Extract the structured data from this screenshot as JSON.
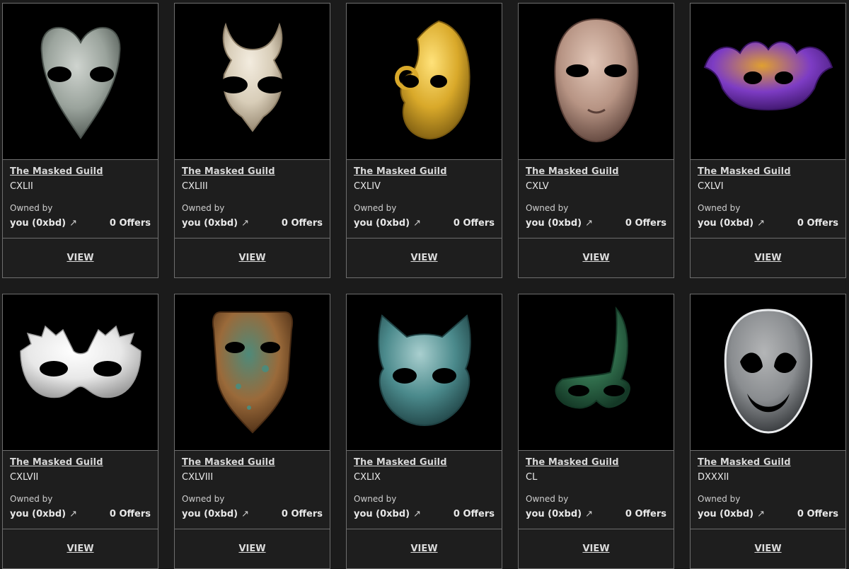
{
  "cards": [
    {
      "collection": "The Masked Guild",
      "token": "CXLII",
      "owned_label": "Owned by",
      "owner": "you (0xbd)",
      "arrow": "↗",
      "offers": "0 Offers",
      "view": "VIEW",
      "mask": "heart",
      "colors": [
        "#9aa39c",
        "#4b534e",
        "#cfd4cf"
      ]
    },
    {
      "collection": "The Masked Guild",
      "token": "CXLIII",
      "owned_label": "Owned by",
      "owner": "you (0xbd)",
      "arrow": "↗",
      "offers": "0 Offers",
      "view": "VIEW",
      "mask": "horned",
      "colors": [
        "#d8cdb8",
        "#8e7f68",
        "#f3ecdf"
      ]
    },
    {
      "collection": "The Masked Guild",
      "token": "CXLIV",
      "owned_label": "Owned by",
      "owner": "you (0xbd)",
      "arrow": "↗",
      "offers": "0 Offers",
      "view": "VIEW",
      "mask": "half",
      "colors": [
        "#d9a92a",
        "#7a5a10",
        "#ffe27a"
      ]
    },
    {
      "collection": "The Masked Guild",
      "token": "CXLV",
      "owned_label": "Owned by",
      "owner": "you (0xbd)",
      "arrow": "↗",
      "offers": "0 Offers",
      "view": "VIEW",
      "mask": "face",
      "colors": [
        "#b79484",
        "#5a4038",
        "#e2c7b8"
      ]
    },
    {
      "collection": "The Masked Guild",
      "token": "CXLVI",
      "owned_label": "Owned by",
      "owner": "you (0xbd)",
      "arrow": "↗",
      "offers": "0 Offers",
      "view": "VIEW",
      "mask": "wide",
      "colors": [
        "#7d3cc4",
        "#3a1466",
        "#e0a030"
      ]
    },
    {
      "collection": "The Masked Guild",
      "token": "CXLVII",
      "owned_label": "Owned by",
      "owner": "you (0xbd)",
      "arrow": "↗",
      "offers": "0 Offers",
      "view": "VIEW",
      "mask": "feather",
      "colors": [
        "#e8e8e8",
        "#9a9a9a",
        "#ffffff"
      ]
    },
    {
      "collection": "The Masked Guild",
      "token": "CXLVIII",
      "owned_label": "Owned by",
      "owner": "you (0xbd)",
      "arrow": "↗",
      "offers": "0 Offers",
      "view": "VIEW",
      "mask": "long",
      "colors": [
        "#9a6a3a",
        "#4a2c14",
        "#4e8a7a"
      ]
    },
    {
      "collection": "The Masked Guild",
      "token": "CXLIX",
      "owned_label": "Owned by",
      "owner": "you (0xbd)",
      "arrow": "↗",
      "offers": "0 Offers",
      "view": "VIEW",
      "mask": "cat",
      "colors": [
        "#4b8a8c",
        "#1f4244",
        "#a9cfcf"
      ]
    },
    {
      "collection": "The Masked Guild",
      "token": "CL",
      "owned_label": "Owned by",
      "owner": "you (0xbd)",
      "arrow": "↗",
      "offers": "0 Offers",
      "view": "VIEW",
      "mask": "domino",
      "colors": [
        "#2f6b4a",
        "#143826",
        "#5aa07a"
      ]
    },
    {
      "collection": "The Masked Guild",
      "token": "DXXXII",
      "owned_label": "Owned by",
      "owner": "you (0xbd)",
      "arrow": "↗",
      "offers": "0 Offers",
      "view": "VIEW",
      "mask": "glass",
      "colors": [
        "#b8bcc0",
        "#3c4044",
        "#f0f2f4"
      ]
    }
  ]
}
